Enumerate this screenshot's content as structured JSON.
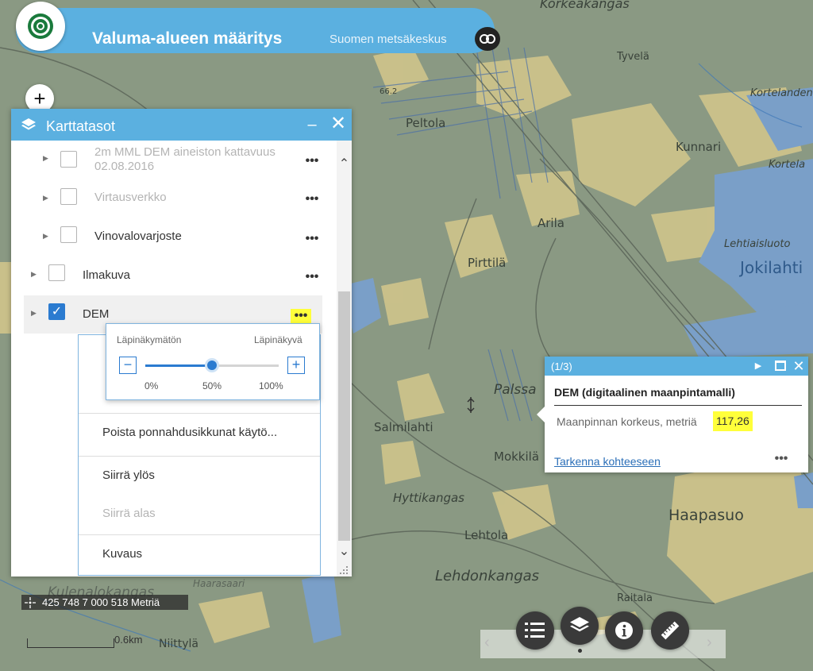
{
  "app": {
    "title": "Valuma-alueen määritys",
    "subtitle": "Suomen metsäkeskus"
  },
  "map": {
    "labels": [
      "Korkeakangas",
      "Tyvelä",
      "Kortelandenn",
      "Peltola",
      "Kunnari",
      "Kortela",
      "Arila",
      "Lehtiaisluoto",
      "Jokilahti",
      "Pirttilä",
      "Palssa",
      "Salmilahti",
      "Mokkilä",
      "Hyttikangas",
      "Haapasuo",
      "Lehtola",
      "Lehdonkangas",
      "Kulenalokangas",
      "Haarasaari",
      "Raitala",
      "Niittylä",
      "66.2"
    ]
  },
  "layer_panel": {
    "title": "Karttatasot",
    "layers": [
      {
        "label": "2m MML DEM aineiston kattavuus 02.08.2016",
        "checked": false,
        "disabled": true
      },
      {
        "label": "Virtausverkko",
        "checked": false,
        "disabled": true
      },
      {
        "label": "Vinovalovarjoste",
        "checked": false,
        "disabled": false
      },
      {
        "label": "Ilmakuva",
        "checked": false,
        "disabled": false
      },
      {
        "label": "DEM",
        "checked": true,
        "disabled": false
      }
    ],
    "more_glyph": "•••",
    "context_menu": [
      {
        "label": "Poista ponnahdusikkunat käytö...",
        "disabled": false
      },
      {
        "label": "Siirrä ylös",
        "disabled": false
      },
      {
        "label": "Siirrä alas",
        "disabled": true
      },
      {
        "label": "Kuvaus",
        "disabled": false
      }
    ],
    "opacity": {
      "left_label": "Läpinäkymätön",
      "right_label": "Läpinäkyvä",
      "value_percent": 50,
      "ticks": [
        "0%",
        "50%",
        "100%"
      ]
    }
  },
  "info_popup": {
    "count": "(1/3)",
    "title": "DEM (digitaalinen maanpintamalli)",
    "field_label": "Maanpinnan korkeus, metriä",
    "field_value": "117,26",
    "zoom_link": "Tarkenna kohteeseen",
    "more_glyph": "•••"
  },
  "coordinates": "425 748 7 000 518 Metriä",
  "scale_label": "0.6km",
  "toolbar": {
    "buttons": [
      "legend-icon",
      "layers-icon",
      "info-icon",
      "measure-icon"
    ],
    "active": "layers-icon"
  },
  "colors": {
    "accent": "#5bb0e0",
    "highlight": "#ffff3a",
    "checkbox": "#2b7bd0",
    "water": "#7a9fc8",
    "field": "#d6c98e"
  }
}
